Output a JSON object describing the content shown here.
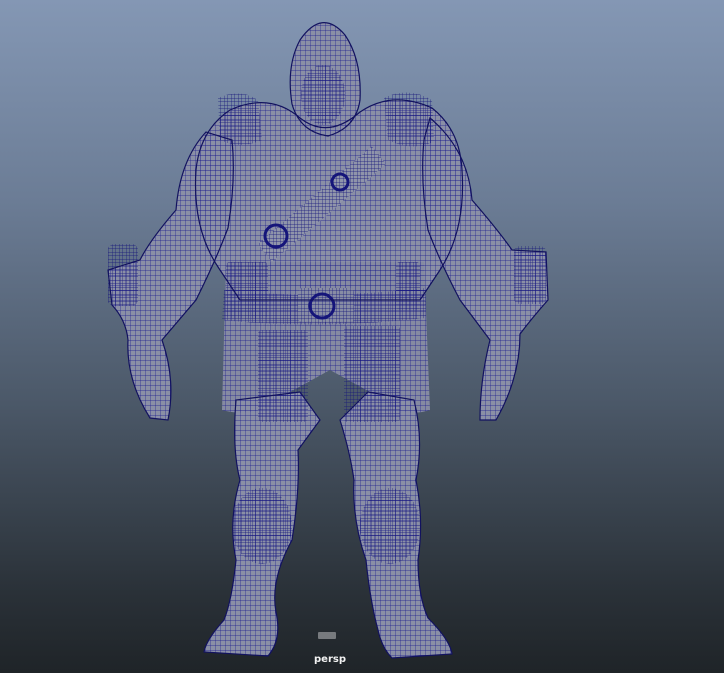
{
  "viewport": {
    "camera_name": "persp",
    "background_top": "#8497b4",
    "background_bottom": "#1f2428"
  },
  "model": {
    "display_mode": "wireframe-on-shaded",
    "wire_color": "#1a1a8e",
    "shaded_color": "#8a8fa6"
  }
}
